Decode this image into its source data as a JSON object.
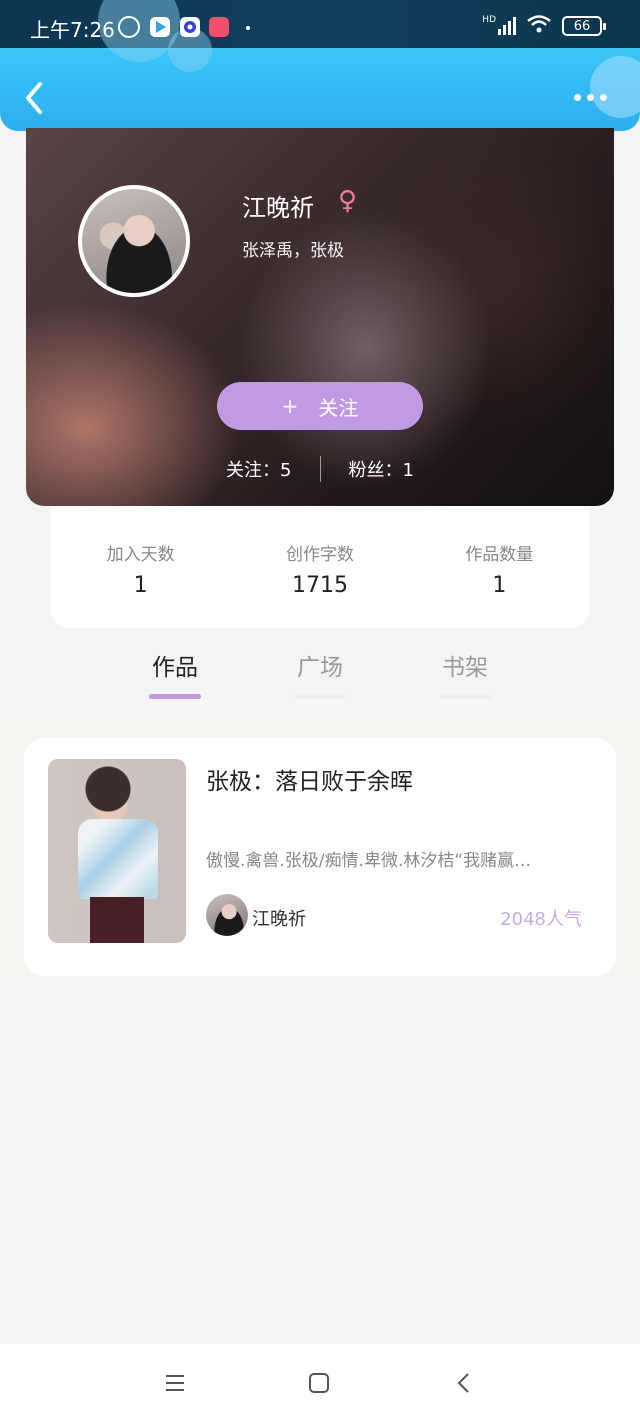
{
  "status_bar": {
    "time": "上午7:26",
    "network": "HD",
    "battery": "66"
  },
  "header": {
    "back_icon": "chevron-left-icon",
    "more_icon": "more-dots-icon"
  },
  "profile": {
    "name": "江晚祈",
    "gender_symbol": "♀",
    "tags": "张泽禹，张极",
    "follow_button": "关注",
    "follow_plus": "+",
    "following_label": "关注：5",
    "fans_label": "粉丝：1"
  },
  "counts": [
    {
      "label": "加入天数",
      "value": "1"
    },
    {
      "label": "创作字数",
      "value": "1715"
    },
    {
      "label": "作品数量",
      "value": "1"
    }
  ],
  "tabs": [
    {
      "label": "作品",
      "active": true
    },
    {
      "label": "广场",
      "active": false
    },
    {
      "label": "书架",
      "active": false
    }
  ],
  "works": [
    {
      "title": "张极：落日败于余晖",
      "description": "傲慢.禽兽.张极/痴情.卑微.林汐桔“我赌赢…",
      "author": "江晚祈",
      "popularity": "2048人气"
    }
  ],
  "nav": {
    "menu_icon": "menu-icon",
    "home_icon": "home-square-icon",
    "back_icon": "back-triangle-icon"
  },
  "colors": {
    "accent": "#c09be3",
    "header_blue": "#2eaef0",
    "popularity": "#c8a9e6"
  }
}
